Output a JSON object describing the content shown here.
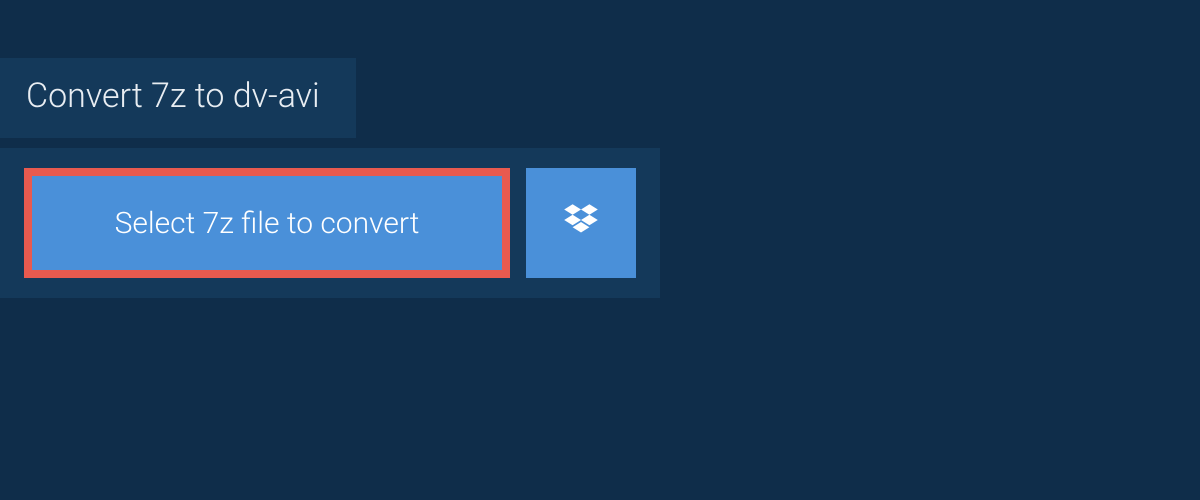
{
  "tab": {
    "title": "Convert 7z to dv-avi"
  },
  "dropzone": {
    "select_label": "Select 7z file to convert"
  },
  "colors": {
    "background": "#0f2d4a",
    "panel": "#14395a",
    "button": "#4a90d9",
    "highlight_border": "#e85a4f",
    "text_light": "#e8edf2",
    "text_white": "#ffffff"
  },
  "icons": {
    "dropbox": "dropbox-icon"
  }
}
